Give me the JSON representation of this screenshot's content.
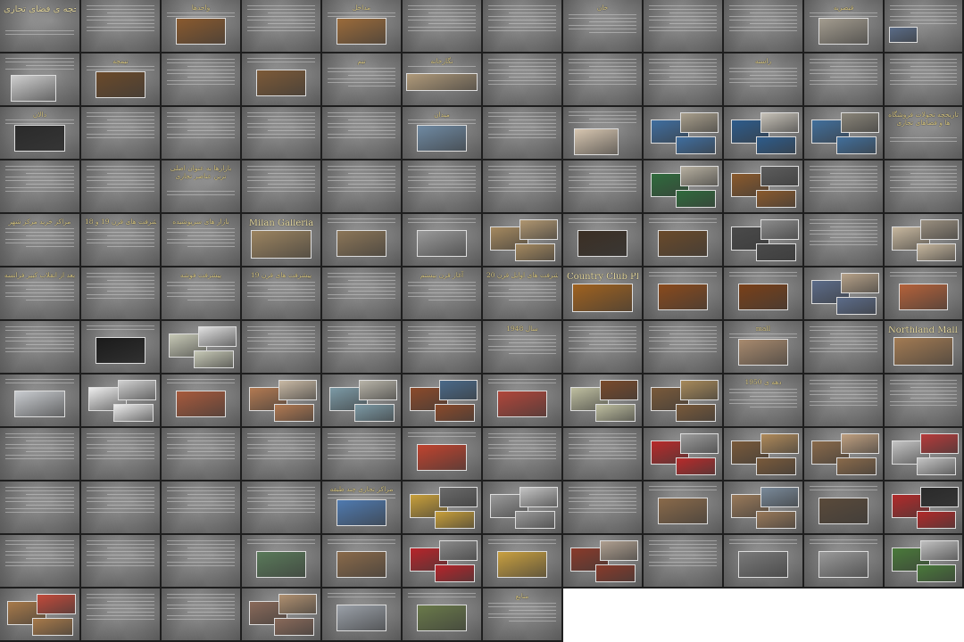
{
  "view": {
    "columns": 12,
    "rows": 12,
    "slide_count": 139
  },
  "slides": [
    {
      "title": "تاریخچه ی فضای تجاری",
      "layout": "title",
      "pics": []
    },
    {
      "title": "",
      "layout": "text",
      "pics": []
    },
    {
      "title": "واحدها",
      "layout": "text-pic",
      "pics": [
        {
          "c": "#8a5a2e"
        }
      ]
    },
    {
      "title": "",
      "layout": "text",
      "pics": []
    },
    {
      "title": "مداخل",
      "layout": "text-pic",
      "pics": [
        {
          "c": "#9b6b3a"
        }
      ]
    },
    {
      "title": "",
      "layout": "text",
      "pics": []
    },
    {
      "title": "",
      "layout": "text",
      "pics": []
    },
    {
      "title": "خان",
      "layout": "text",
      "pics": []
    },
    {
      "title": "",
      "layout": "text",
      "pics": []
    },
    {
      "title": "",
      "layout": "text",
      "pics": []
    },
    {
      "title": "قیصریه",
      "layout": "text-pic",
      "pics": [
        {
          "c": "#a39c8f"
        }
      ]
    },
    {
      "title": "",
      "layout": "text-pic-left",
      "pics": [
        {
          "c": "#5a6c88"
        }
      ]
    },
    {
      "title": "",
      "layout": "text-pic-bottom",
      "pics": [
        {
          "c": "#cfcfcf"
        }
      ]
    },
    {
      "title": "تیمچه",
      "layout": "text-pic",
      "pics": [
        {
          "c": "#6b4a2a"
        }
      ]
    },
    {
      "title": "",
      "layout": "text",
      "pics": []
    },
    {
      "title": "",
      "layout": "text-pic",
      "pics": [
        {
          "c": "#7d5a37"
        }
      ]
    },
    {
      "title": "تیم",
      "layout": "text",
      "pics": []
    },
    {
      "title": "نگارخانه",
      "layout": "text-pic-wide",
      "pics": [
        {
          "c": "#b09a7a"
        }
      ]
    },
    {
      "title": "",
      "layout": "text",
      "pics": []
    },
    {
      "title": "",
      "layout": "text",
      "pics": []
    },
    {
      "title": "",
      "layout": "text",
      "pics": []
    },
    {
      "title": "راسته",
      "layout": "text",
      "pics": []
    },
    {
      "title": "",
      "layout": "text",
      "pics": []
    },
    {
      "title": "",
      "layout": "text",
      "pics": []
    },
    {
      "title": "دالان",
      "layout": "text-pic",
      "pics": [
        {
          "c": "#2a2a2a"
        }
      ]
    },
    {
      "title": "",
      "layout": "text",
      "pics": []
    },
    {
      "title": "",
      "layout": "text",
      "pics": []
    },
    {
      "title": "",
      "layout": "text",
      "pics": []
    },
    {
      "title": "",
      "layout": "text",
      "pics": []
    },
    {
      "title": "میدان",
      "layout": "text-pic",
      "pics": [
        {
          "c": "#6f8aa3"
        }
      ]
    },
    {
      "title": "",
      "layout": "text",
      "pics": []
    },
    {
      "title": "",
      "layout": "text-pic-bottom",
      "pics": [
        {
          "c": "#d7c6b0"
        }
      ]
    },
    {
      "title": "",
      "layout": "collage",
      "pics": [
        {
          "c": "#3f6ea0"
        },
        {
          "c": "#a99f8c"
        }
      ]
    },
    {
      "title": "",
      "layout": "collage",
      "pics": [
        {
          "c": "#2d5c8c"
        },
        {
          "c": "#c7c2b8"
        }
      ]
    },
    {
      "title": "",
      "layout": "collage",
      "pics": [
        {
          "c": "#416f9c"
        },
        {
          "c": "#8a8579"
        }
      ]
    },
    {
      "title": "تاریخچه تحولات فروشگاه ها و فضاهای تجاری",
      "layout": "title2",
      "pics": []
    },
    {
      "title": "",
      "layout": "text",
      "pics": []
    },
    {
      "title": "",
      "layout": "text",
      "pics": []
    },
    {
      "title": "بازارها به عنوان اصلی ترین عناصر تجاری",
      "layout": "title2",
      "pics": []
    },
    {
      "title": "",
      "layout": "text",
      "pics": []
    },
    {
      "title": "",
      "layout": "text",
      "pics": []
    },
    {
      "title": "",
      "layout": "text",
      "pics": []
    },
    {
      "title": "",
      "layout": "text",
      "pics": []
    },
    {
      "title": "",
      "layout": "text",
      "pics": []
    },
    {
      "title": "",
      "layout": "collage",
      "pics": [
        {
          "c": "#2f6b3c"
        },
        {
          "c": "#b7b0a0"
        }
      ]
    },
    {
      "title": "",
      "layout": "collage",
      "pics": [
        {
          "c": "#8b5a2c"
        },
        {
          "c": "#5d5d5d"
        }
      ]
    },
    {
      "title": "",
      "layout": "text",
      "pics": []
    },
    {
      "title": "",
      "layout": "text",
      "pics": []
    },
    {
      "title": "مراکز خرید مرکز شهر",
      "layout": "text",
      "pics": []
    },
    {
      "title": "پیشرفت های قرن 19 و 18",
      "layout": "text",
      "pics": []
    },
    {
      "title": "بازار های سرپوشیده",
      "layout": "text",
      "pics": []
    },
    {
      "title": "Milan Galleria",
      "layout": "title-pic",
      "pics": [
        {
          "c": "#9c8460"
        }
      ]
    },
    {
      "title": "",
      "layout": "text-pic",
      "pics": [
        {
          "c": "#8c7658"
        }
      ]
    },
    {
      "title": "",
      "layout": "text-pic",
      "pics": [
        {
          "c": "#9a9a9a"
        }
      ]
    },
    {
      "title": "",
      "layout": "collage",
      "pics": [
        {
          "c": "#a5895f"
        },
        {
          "c": "#b09670"
        }
      ]
    },
    {
      "title": "",
      "layout": "text-pic",
      "pics": [
        {
          "c": "#3b2f24"
        }
      ]
    },
    {
      "title": "",
      "layout": "text-pic",
      "pics": [
        {
          "c": "#6a4a2a"
        }
      ]
    },
    {
      "title": "",
      "layout": "collage",
      "pics": [
        {
          "c": "#4a4a4a"
        },
        {
          "c": "#8c8c8c"
        }
      ]
    },
    {
      "title": "",
      "layout": "text",
      "pics": []
    },
    {
      "title": "",
      "layout": "collage",
      "pics": [
        {
          "c": "#c8b89f"
        },
        {
          "c": "#9a8f7f"
        }
      ]
    },
    {
      "title": "بعد از انقلاب کبیر فرانسه",
      "layout": "text",
      "pics": []
    },
    {
      "title": "",
      "layout": "text",
      "pics": []
    },
    {
      "title": "پیشرفت فوشه",
      "layout": "text",
      "pics": []
    },
    {
      "title": "پیشرفت های قرن 19",
      "layout": "text",
      "pics": []
    },
    {
      "title": "",
      "layout": "text",
      "pics": []
    },
    {
      "title": "آغاز قرن بیستم",
      "layout": "text",
      "pics": []
    },
    {
      "title": "پیشرفت های اوایل قرن 20",
      "layout": "text",
      "pics": []
    },
    {
      "title": "Country Club Plaza",
      "layout": "title-pic",
      "pics": [
        {
          "c": "#a0621f"
        }
      ]
    },
    {
      "title": "",
      "layout": "text-pic",
      "pics": [
        {
          "c": "#8a4a1c"
        }
      ]
    },
    {
      "title": "",
      "layout": "text-pic",
      "pics": [
        {
          "c": "#7a4018"
        }
      ]
    },
    {
      "title": "",
      "layout": "collage",
      "pics": [
        {
          "c": "#5c6c8a"
        },
        {
          "c": "#b7a289"
        }
      ]
    },
    {
      "title": "",
      "layout": "text-pic",
      "pics": [
        {
          "c": "#b5623a"
        }
      ]
    },
    {
      "title": "",
      "layout": "text",
      "pics": []
    },
    {
      "title": "",
      "layout": "text-pic",
      "pics": [
        {
          "c": "#1a1a1a"
        }
      ]
    },
    {
      "title": "",
      "layout": "collage",
      "pics": [
        {
          "c": "#c7c9b6"
        },
        {
          "c": "#e0e0e0"
        }
      ]
    },
    {
      "title": "",
      "layout": "text",
      "pics": []
    },
    {
      "title": "",
      "layout": "text",
      "pics": []
    },
    {
      "title": "",
      "layout": "text",
      "pics": []
    },
    {
      "title": "سال 1948",
      "layout": "text",
      "pics": []
    },
    {
      "title": "",
      "layout": "text",
      "pics": []
    },
    {
      "title": "",
      "layout": "text",
      "pics": []
    },
    {
      "title": "mall",
      "layout": "text-pic",
      "pics": [
        {
          "c": "#a88a6e"
        }
      ]
    },
    {
      "title": "",
      "layout": "text",
      "pics": []
    },
    {
      "title": "Northland Mall_1954",
      "layout": "title-pic",
      "pics": [
        {
          "c": "#a37b53"
        }
      ]
    },
    {
      "title": "",
      "layout": "text-pic",
      "pics": [
        {
          "c": "#c9ccd0"
        }
      ]
    },
    {
      "title": "",
      "layout": "collage",
      "pics": [
        {
          "c": "#ededed"
        },
        {
          "c": "#d0d0d0"
        }
      ]
    },
    {
      "title": "",
      "layout": "text-pic",
      "pics": [
        {
          "c": "#a85a3c"
        }
      ]
    },
    {
      "title": "",
      "layout": "collage",
      "pics": [
        {
          "c": "#b37a52"
        },
        {
          "c": "#c9b9a4"
        }
      ]
    },
    {
      "title": "",
      "layout": "collage",
      "pics": [
        {
          "c": "#7c9aa6"
        },
        {
          "c": "#b8b4a8"
        }
      ]
    },
    {
      "title": "",
      "layout": "collage",
      "pics": [
        {
          "c": "#8c4a2a"
        },
        {
          "c": "#4a6a8a"
        }
      ]
    },
    {
      "title": "",
      "layout": "text-pic",
      "pics": [
        {
          "c": "#b1463a"
        }
      ]
    },
    {
      "title": "",
      "layout": "collage",
      "pics": [
        {
          "c": "#bfbfa0"
        },
        {
          "c": "#7a4a2a"
        }
      ]
    },
    {
      "title": "",
      "layout": "collage",
      "pics": [
        {
          "c": "#7a5a3a"
        },
        {
          "c": "#a88a5a"
        }
      ]
    },
    {
      "title": "دهه ی 1950",
      "layout": "text",
      "pics": []
    },
    {
      "title": "",
      "layout": "text",
      "pics": []
    },
    {
      "title": "",
      "layout": "text",
      "pics": []
    },
    {
      "title": "",
      "layout": "text",
      "pics": []
    },
    {
      "title": "",
      "layout": "text",
      "pics": []
    },
    {
      "title": "",
      "layout": "text",
      "pics": []
    },
    {
      "title": "",
      "layout": "text",
      "pics": []
    },
    {
      "title": "",
      "layout": "text",
      "pics": []
    },
    {
      "title": "",
      "layout": "text-pic",
      "pics": [
        {
          "c": "#c1432e"
        }
      ]
    },
    {
      "title": "",
      "layout": "text",
      "pics": []
    },
    {
      "title": "",
      "layout": "text",
      "pics": []
    },
    {
      "title": "",
      "layout": "collage",
      "pics": [
        {
          "c": "#b92a2a"
        },
        {
          "c": "#9c9c9c"
        }
      ]
    },
    {
      "title": "",
      "layout": "collage",
      "pics": [
        {
          "c": "#7a5a3a"
        },
        {
          "c": "#b08a5a"
        }
      ]
    },
    {
      "title": "",
      "layout": "collage",
      "pics": [
        {
          "c": "#8a6a4a"
        },
        {
          "c": "#c0a080"
        }
      ]
    },
    {
      "title": "",
      "layout": "collage",
      "pics": [
        {
          "c": "#c4c4c4"
        },
        {
          "c": "#b73a3a"
        }
      ]
    },
    {
      "title": "",
      "layout": "text",
      "pics": []
    },
    {
      "title": "",
      "layout": "text",
      "pics": []
    },
    {
      "title": "",
      "layout": "text",
      "pics": []
    },
    {
      "title": "",
      "layout": "text",
      "pics": []
    },
    {
      "title": "مراکز تجاری چند طبقه",
      "layout": "text-pic",
      "pics": [
        {
          "c": "#4f7ab0"
        }
      ]
    },
    {
      "title": "",
      "layout": "collage",
      "pics": [
        {
          "c": "#c9a03a"
        },
        {
          "c": "#6a6a6a"
        }
      ]
    },
    {
      "title": "",
      "layout": "collage",
      "pics": [
        {
          "c": "#9a9a9a"
        },
        {
          "c": "#c4c4c4"
        }
      ]
    },
    {
      "title": "",
      "layout": "text",
      "pics": []
    },
    {
      "title": "",
      "layout": "text-pic",
      "pics": [
        {
          "c": "#8a6a4a"
        }
      ]
    },
    {
      "title": "",
      "layout": "collage",
      "pics": [
        {
          "c": "#9a7a5a"
        },
        {
          "c": "#7a8a9a"
        }
      ]
    },
    {
      "title": "",
      "layout": "text-pic",
      "pics": [
        {
          "c": "#5a4a3a"
        }
      ]
    },
    {
      "title": "",
      "layout": "collage",
      "pics": [
        {
          "c": "#b32a2a"
        },
        {
          "c": "#2a2a2a"
        }
      ]
    },
    {
      "title": "",
      "layout": "text",
      "pics": []
    },
    {
      "title": "",
      "layout": "text",
      "pics": []
    },
    {
      "title": "",
      "layout": "text",
      "pics": []
    },
    {
      "title": "",
      "layout": "text-pic",
      "pics": [
        {
          "c": "#5a7a5a"
        }
      ]
    },
    {
      "title": "",
      "layout": "text-pic",
      "pics": [
        {
          "c": "#8a6a4a"
        }
      ]
    },
    {
      "title": "",
      "layout": "collage",
      "pics": [
        {
          "c": "#b8242a"
        },
        {
          "c": "#8a8a8a"
        }
      ]
    },
    {
      "title": "",
      "layout": "text-pic",
      "pics": [
        {
          "c": "#c9a040"
        }
      ]
    },
    {
      "title": "",
      "layout": "collage",
      "pics": [
        {
          "c": "#8a3a2a"
        },
        {
          "c": "#b0a090"
        }
      ]
    },
    {
      "title": "",
      "layout": "text",
      "pics": []
    },
    {
      "title": "",
      "layout": "text-pic",
      "pics": [
        {
          "c": "#7a7a7a"
        }
      ]
    },
    {
      "title": "",
      "layout": "text-pic",
      "pics": [
        {
          "c": "#9a9a9a"
        }
      ]
    },
    {
      "title": "",
      "layout": "collage",
      "pics": [
        {
          "c": "#4a7a3a"
        },
        {
          "c": "#c0c0c0"
        }
      ]
    },
    {
      "title": "",
      "layout": "collage",
      "pics": [
        {
          "c": "#a87a4a"
        },
        {
          "c": "#c44a3a"
        }
      ]
    },
    {
      "title": "",
      "layout": "text",
      "pics": []
    },
    {
      "title": "",
      "layout": "text",
      "pics": []
    },
    {
      "title": "",
      "layout": "collage",
      "pics": [
        {
          "c": "#8a6a5a"
        },
        {
          "c": "#b09070"
        }
      ]
    },
    {
      "title": "",
      "layout": "text-pic",
      "pics": [
        {
          "c": "#9aa0a8"
        }
      ]
    },
    {
      "title": "",
      "layout": "text-pic",
      "pics": [
        {
          "c": "#6a7a4a"
        }
      ]
    },
    {
      "title": "منابع",
      "layout": "text",
      "pics": []
    }
  ]
}
